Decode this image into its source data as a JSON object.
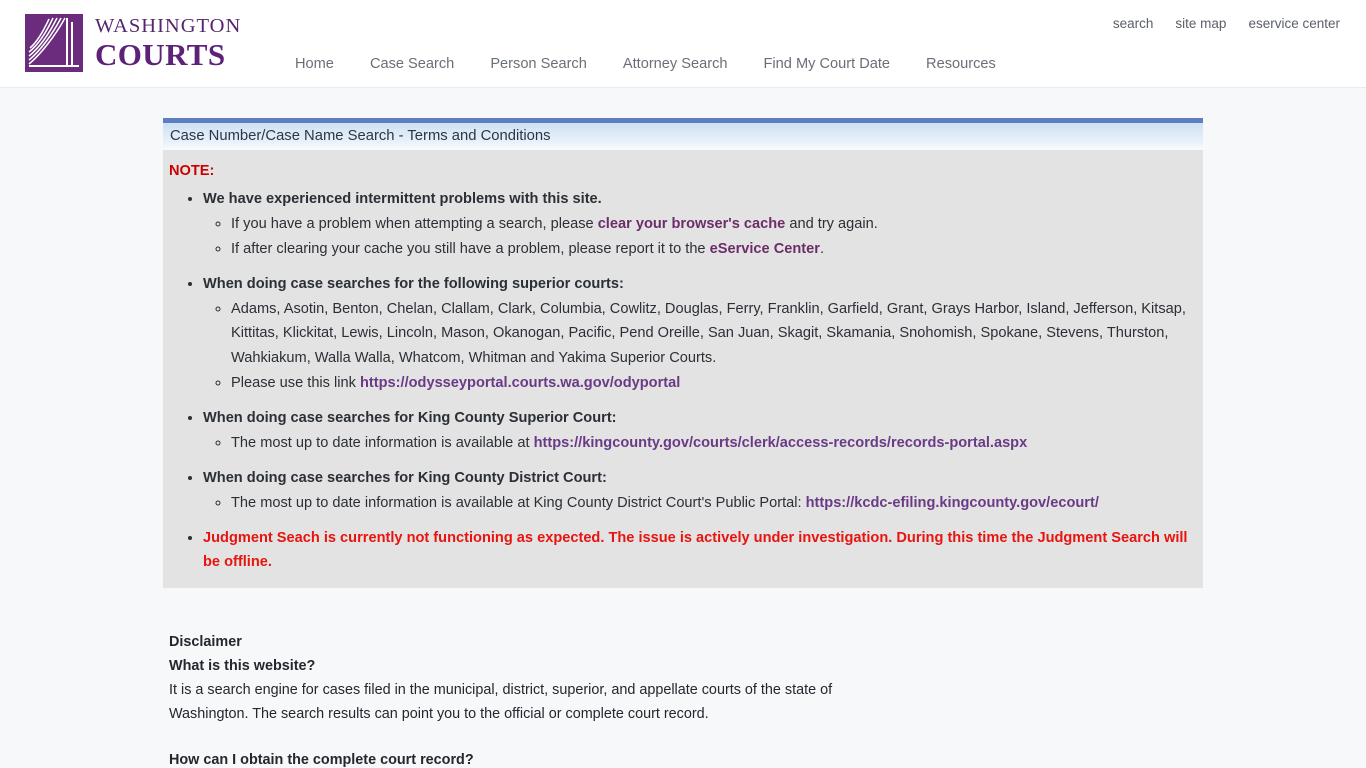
{
  "header": {
    "brand": {
      "logo_icon": "washington-courts-fan-logo",
      "line1": "WASHINGTON",
      "line2": "COURTS"
    },
    "utility_nav": [
      {
        "label": "search"
      },
      {
        "label": "site map"
      },
      {
        "label": "eservice center"
      }
    ],
    "main_nav": [
      {
        "label": "Home"
      },
      {
        "label": "Case Search"
      },
      {
        "label": "Person Search"
      },
      {
        "label": "Attorney Search"
      },
      {
        "label": "Find My Court Date"
      },
      {
        "label": "Resources"
      }
    ]
  },
  "panel": {
    "title": "Case Number/Case Name Search - Terms and Conditions",
    "note_label": "NOTE:",
    "bullets": {
      "b1": {
        "heading": "We have experienced intermittent problems with this site.",
        "sub1_pre": "If you have a problem when attempting a search, please ",
        "sub1_link": "clear your browser's cache",
        "sub1_post": " and try again.",
        "sub2_pre": "If after clearing your cache you still have a problem, please report it to the ",
        "sub2_link": "eService Center",
        "sub2_post": "."
      },
      "b2": {
        "heading": "When doing case searches for the following superior courts:",
        "sub1": "Adams, Asotin, Benton, Chelan, Clallam, Clark, Columbia, Cowlitz, Douglas, Ferry, Franklin, Garfield, Grant, Grays Harbor, Island, Jefferson, Kitsap, Kittitas, Klickitat, Lewis, Lincoln, Mason, Okanogan, Pacific, Pend Oreille, San Juan, Skagit, Skamania, Snohomish, Spokane, Stevens, Thurston, Wahkiakum, Walla Walla, Whatcom, Whitman and Yakima Superior Courts.",
        "sub2_pre": "Please use this link ",
        "sub2_link": "https://odysseyportal.courts.wa.gov/odyportal"
      },
      "b3": {
        "heading": "When doing case searches for King County Superior Court:",
        "sub1_pre": "The most up to date information is available at ",
        "sub1_link": "https://kingcounty.gov/courts/clerk/access-records/records-portal.aspx"
      },
      "b4": {
        "heading": "When doing case searches for King County District Court:",
        "sub1_pre": "The most up to date information is available at King County District Court's Public Portal: ",
        "sub1_link": "https://kcdc-efiling.kingcounty.gov/ecourt/"
      },
      "b5": {
        "alert": "Judgment Seach is currently not functioning as expected. The issue is actively under investigation. During this time the Judgment Search will be offline."
      }
    }
  },
  "disclaimer": {
    "title": "Disclaimer",
    "q1": "What is this website?",
    "a1_line1": "It is a search engine for cases filed in the municipal, district, superior, and appellate courts of the state of",
    "a1_line2": "Washington. The search results can point you to the official or complete court record.",
    "q2": "How can I obtain the complete court record?"
  },
  "colors": {
    "brand_purple": "#5d2277",
    "titlebar_blue": "#5c7fc0",
    "note_bg": "#e3e3e3",
    "note_label_red": "#cc0000",
    "alert_red": "#e8140f",
    "link_purple": "#6c2d68",
    "page_bg": "#f7f8fa"
  }
}
